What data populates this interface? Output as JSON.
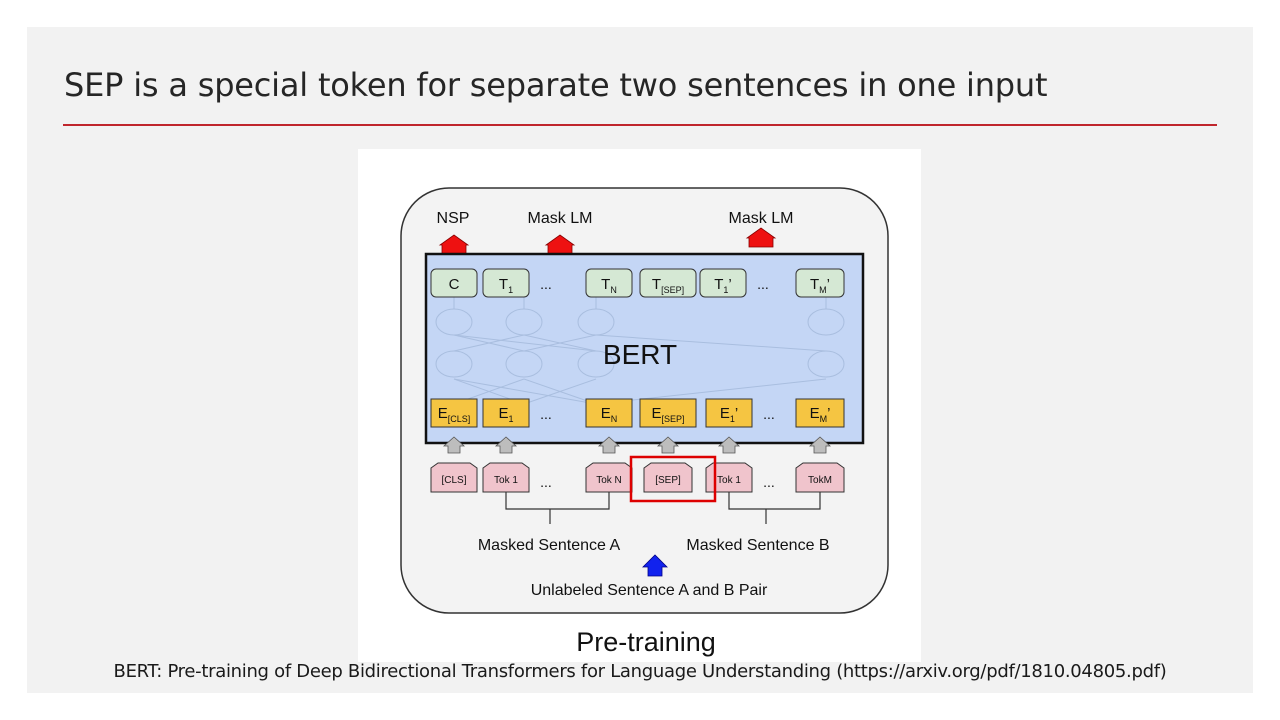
{
  "slide": {
    "title": "SEP is a special token for separate two sentences in one input",
    "caption": "BERT: Pre-training of Deep Bidirectional Transformers for Language Understanding (https://arxiv.org/pdf/1810.04805.pdf)",
    "accent_color": "#c0262d"
  },
  "diagram": {
    "heads": [
      "NSP",
      "Mask LM",
      "Mask LM"
    ],
    "model_label": "BERT",
    "outputs": [
      {
        "base": "C",
        "sub": "",
        "prime": ""
      },
      {
        "base": "T",
        "sub": "1",
        "prime": ""
      },
      {
        "base": "T",
        "sub": "N",
        "prime": ""
      },
      {
        "base": "T",
        "sub": "[SEP]",
        "prime": ""
      },
      {
        "base": "T",
        "sub": "1",
        "prime": "’"
      },
      {
        "base": "T",
        "sub": "M",
        "prime": "’"
      }
    ],
    "embeddings": [
      {
        "base": "E",
        "sub": "[CLS]",
        "prime": ""
      },
      {
        "base": "E",
        "sub": "1",
        "prime": ""
      },
      {
        "base": "E",
        "sub": "N",
        "prime": ""
      },
      {
        "base": "E",
        "sub": "[SEP]",
        "prime": ""
      },
      {
        "base": "E",
        "sub": "1",
        "prime": "’"
      },
      {
        "base": "E",
        "sub": "M",
        "prime": "’"
      }
    ],
    "tokens": [
      "[CLS]",
      "Tok 1",
      "Tok N",
      "[SEP]",
      "Tok 1",
      "TokM"
    ],
    "ellipsis": "...",
    "sentence_a": "Masked Sentence A",
    "sentence_b": "Masked Sentence B",
    "pair_label": "Unlabeled Sentence A and B Pair",
    "stage_label": "Pre-training",
    "highlight_token": "[SEP]",
    "colors": {
      "output_box": "#d5e8d4",
      "embedding_box": "#f5c542",
      "token_box": "#f0c4cc",
      "model_fill": "#c4d6f5",
      "head_arrow": "#ee1111",
      "input_arrow": "#1122ee",
      "highlight": "#dd0000"
    }
  }
}
